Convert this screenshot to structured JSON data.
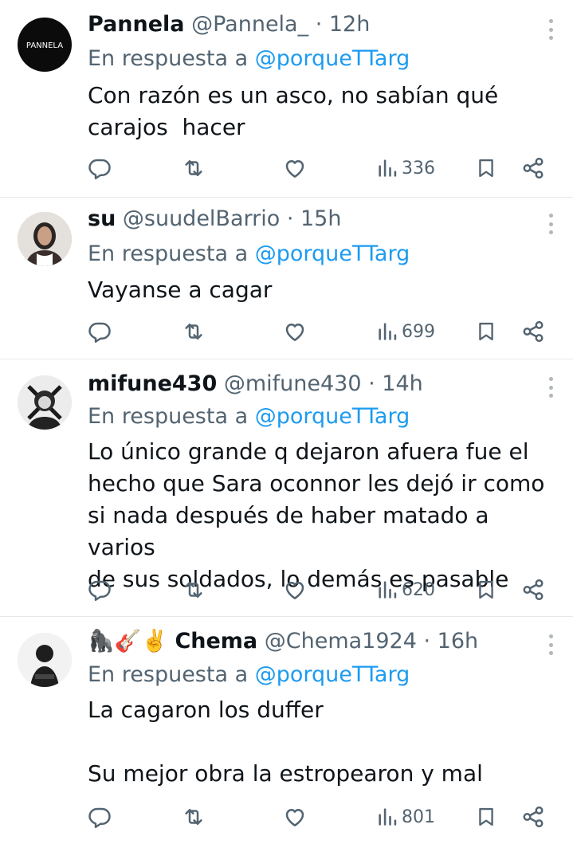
{
  "reply_prefix": "En respuesta a",
  "colors": {
    "link": "#1d9bf0",
    "secondary": "#536471",
    "icon": "#536471"
  },
  "tweets": [
    {
      "name": "Pannela",
      "handle": "@Pannela_",
      "time": "· 12h",
      "reply_to": "@porqueTTarg",
      "text": "Con razón es un asco, no sabían qué\ncarajos  hacer",
      "views": "336",
      "avatar_icon": "pannela-logo-avatar",
      "avatar_text": "PANNELA"
    },
    {
      "name": "su",
      "handle": "@suudelBarrio",
      "time": "· 15h",
      "reply_to": "@porqueTTarg",
      "text": "Vayanse a cagar",
      "views": "699",
      "avatar_icon": "user-photo-avatar"
    },
    {
      "name": "mifune430",
      "handle": "@mifune430",
      "time": "· 14h",
      "reply_to": "@porqueTTarg",
      "text": "Lo único grande q dejaron afuera fue el\nhecho que Sara oconnor les dejó ir como\nsi nada después de haber matado a varios\nde sus soldados, lo demás es pasable",
      "views": "620",
      "avatar_icon": "user-photo-avatar"
    },
    {
      "name": "Chema",
      "name_emoji": "🦍🎸✌️",
      "handle": "@Chema1924",
      "time": "· 16h",
      "reply_to": "@porqueTTarg",
      "text": "La cagaron los duffer\n\nSu mejor obra la estropearon y mal",
      "views": "801",
      "avatar_icon": "user-photo-avatar"
    }
  ]
}
